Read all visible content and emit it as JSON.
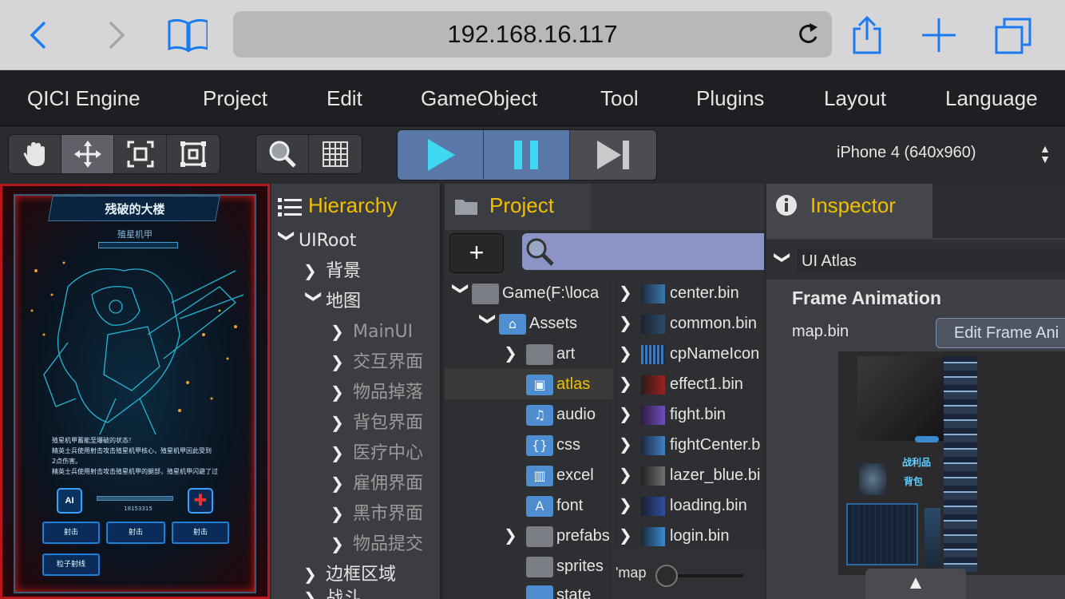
{
  "browser": {
    "url": "192.168.16.117",
    "icons": [
      "back-icon",
      "forward-icon",
      "bookmarks-icon",
      "reload-icon",
      "share-icon",
      "new-tab-icon",
      "tabs-icon"
    ]
  },
  "menu": {
    "items": [
      "QICI Engine",
      "Project",
      "Edit",
      "GameObject",
      "Tool",
      "Plugins",
      "Layout",
      "Language"
    ]
  },
  "toolbar": {
    "device": "iPhone 4 (640x960)"
  },
  "game": {
    "title": "残破的大楼",
    "subtitle": "殖星机甲",
    "lines": [
      "殖星机甲蓄能至爆破的状态！",
      "精英士兵使用射击攻击殖星机甲核心，殖星机甲因此受到",
      "2点伤害。",
      "精英士兵使用射击攻击殖星机甲的腿部，殖星机甲闪避了过"
    ],
    "ai_label": "AI",
    "hp_text": "18153315",
    "buttons": [
      "射击",
      "射击",
      "射击",
      "粒子射线"
    ]
  },
  "hierarchy": {
    "title": "Hierarchy",
    "rows": [
      {
        "label": "UIRoot",
        "expanded": true
      },
      {
        "label": "背景",
        "expanded": false
      },
      {
        "label": "地图",
        "expanded": true
      },
      {
        "label": "MainUI",
        "expanded": false
      },
      {
        "label": "交互界面",
        "expanded": false
      },
      {
        "label": "物品掉落",
        "expanded": false
      },
      {
        "label": "背包界面",
        "expanded": false
      },
      {
        "label": "医疗中心",
        "expanded": false
      },
      {
        "label": "雇佣界面",
        "expanded": false
      },
      {
        "label": "黑市界面",
        "expanded": false
      },
      {
        "label": "物品提交",
        "expanded": false
      },
      {
        "label": "边框区域",
        "expanded": false
      },
      {
        "label": "战斗",
        "expanded": false
      }
    ]
  },
  "project": {
    "title": "Project",
    "add_label": "+",
    "tree": [
      {
        "label": "Game(F:\\loca",
        "arrow": "down"
      },
      {
        "label": "Assets",
        "arrow": "down"
      },
      {
        "label": "art",
        "arrow": "right"
      },
      {
        "label": "atlas",
        "arrow": "",
        "selected": true
      },
      {
        "label": "audio",
        "arrow": "",
        "glyph": "♫"
      },
      {
        "label": "css",
        "arrow": "",
        "glyph": "{}"
      },
      {
        "label": "excel",
        "arrow": "",
        "glyph": "▥"
      },
      {
        "label": "font",
        "arrow": "",
        "glyph": "A"
      },
      {
        "label": "prefabs",
        "arrow": "right"
      },
      {
        "label": "sprites",
        "arrow": ""
      },
      {
        "label": "state",
        "arrow": ""
      }
    ],
    "files": [
      "center.bin",
      "common.bin",
      "cpNameIcon",
      "effect1.bin",
      "fight.bin",
      "fightCenter.b",
      "lazer_blue.bi",
      "loading.bin",
      "login.bin"
    ],
    "filter_text": "'map"
  },
  "inspector": {
    "title": "Inspector",
    "component": "UI Atlas",
    "section_title": "Frame Animation",
    "asset_name": "map.bin",
    "edit_button": "Edit Frame Ani",
    "preview_labels": [
      "战利品",
      "背包"
    ],
    "bottom_tab": "▲"
  },
  "colors": {
    "accent_yellow": "#f0c000",
    "play_blue": "#5a79a8",
    "play_cyan": "#3fd8f0",
    "game_red": "#b8161a"
  }
}
